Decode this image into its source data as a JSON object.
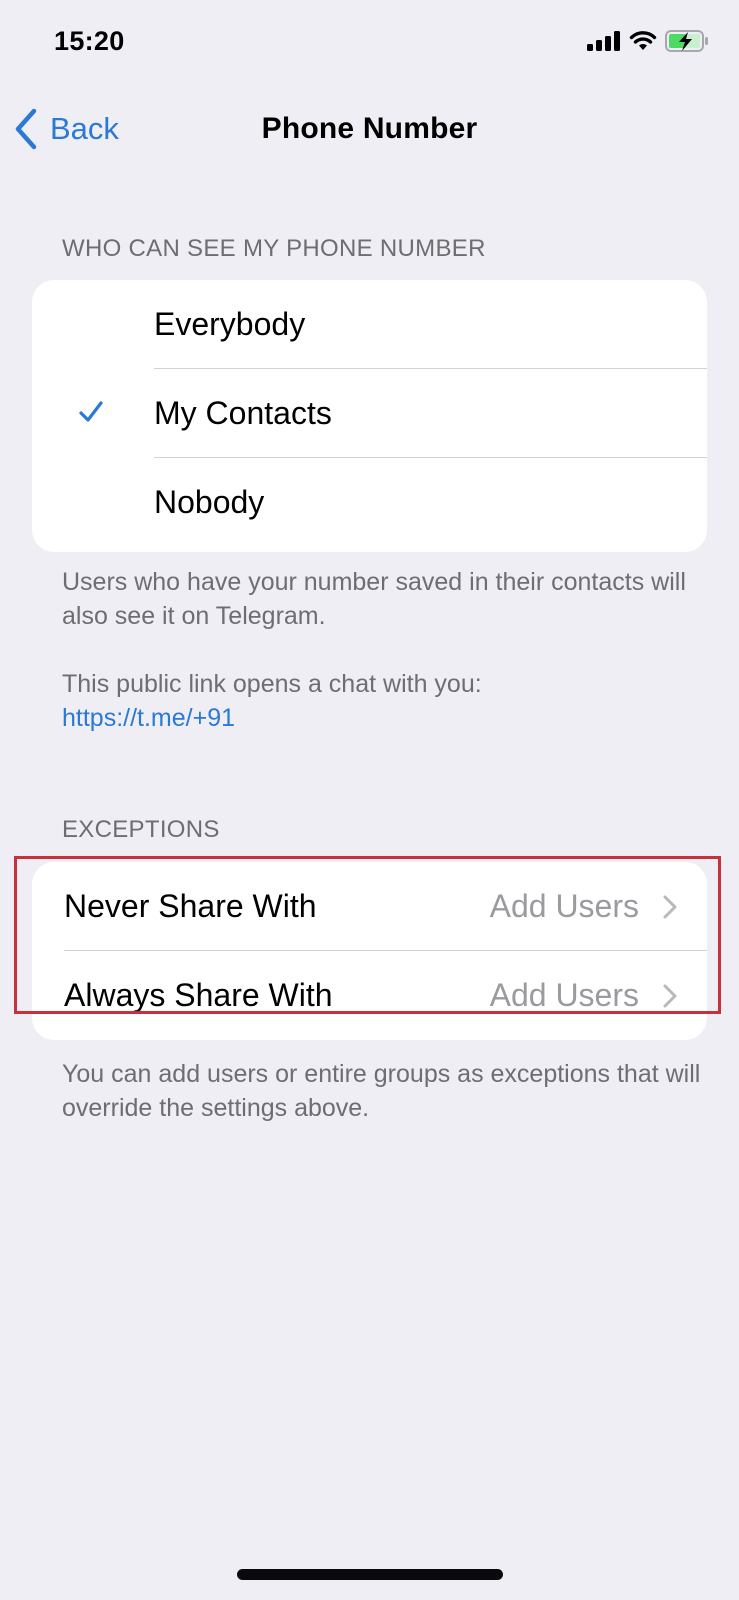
{
  "status_bar": {
    "time": "15:20",
    "icons": [
      "cellular-signal-icon",
      "wifi-icon",
      "battery-charging-icon"
    ]
  },
  "nav": {
    "back_label": "Back",
    "title": "Phone Number"
  },
  "visibility": {
    "header": "WHO CAN SEE MY PHONE NUMBER",
    "options": [
      {
        "label": "Everybody",
        "selected": false
      },
      {
        "label": "My Contacts",
        "selected": true
      },
      {
        "label": "Nobody",
        "selected": false
      }
    ],
    "footer_line1": "Users who have your number saved in their contacts will also see it on Telegram.",
    "footer_line2": "This public link opens a chat with you:",
    "link": "https://t.me/+91"
  },
  "exceptions": {
    "header": "EXCEPTIONS",
    "rows": [
      {
        "label": "Never Share With",
        "value": "Add Users"
      },
      {
        "label": "Always Share With",
        "value": "Add Users"
      }
    ],
    "footer": "You can add users or entire groups as exceptions that will override the settings above."
  },
  "colors": {
    "accent": "#2a7ad5",
    "background": "#efeef4",
    "highlight_border": "#c8303c",
    "battery_green": "#4cd964"
  }
}
